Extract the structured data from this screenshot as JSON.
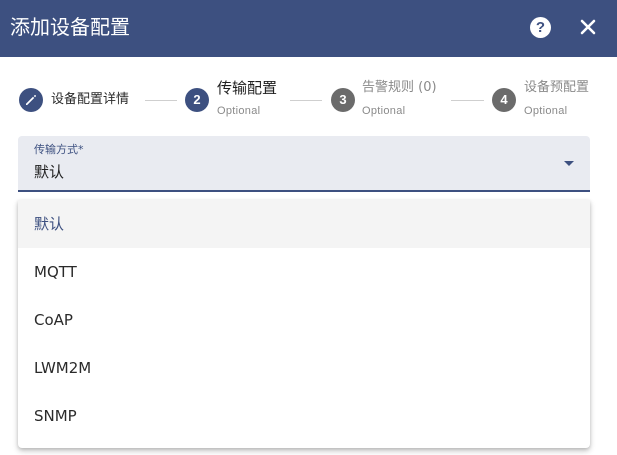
{
  "dialog": {
    "title": "添加设备配置",
    "help_icon": "help-circle-icon",
    "help_glyph": "?",
    "close_icon": "close-icon"
  },
  "stepper": {
    "steps": [
      {
        "icon": "edit-pencil-icon",
        "label": "设备配置详情",
        "state": "editing"
      },
      {
        "number": "2",
        "label": "传输配置",
        "sub": "Optional",
        "state": "active"
      },
      {
        "number": "3",
        "label": "告警规则 (0)",
        "sub": "Optional",
        "state": "inactive"
      },
      {
        "number": "4",
        "label": "设备预配置",
        "sub": "Optional",
        "state": "inactive"
      }
    ]
  },
  "transport_select": {
    "label": "传输方式*",
    "value": "默认",
    "arrow_icon": "dropdown-arrow-icon",
    "options": [
      "默认",
      "MQTT",
      "CoAP",
      "LWM2M",
      "SNMP"
    ],
    "selected_index": 0
  },
  "colors": {
    "primary": "#3d5080",
    "inactive_step": "#6b6b6b",
    "field_background": "#e9ebf1"
  }
}
